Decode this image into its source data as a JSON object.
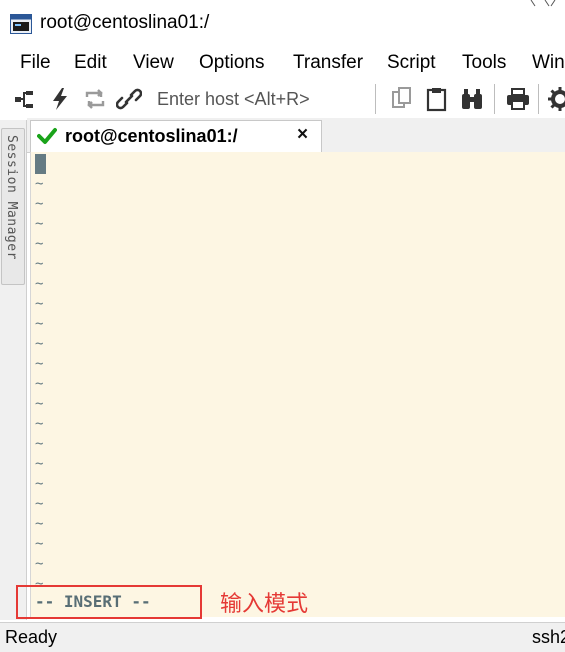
{
  "window": {
    "title": "root@centoslina01:/"
  },
  "menu": [
    "File",
    "Edit",
    "View",
    "Options",
    "Transfer",
    "Script",
    "Tools",
    "Win"
  ],
  "toolbar": {
    "host_placeholder": "Enter host <Alt+R>",
    "icons": [
      "connect-tree-icon",
      "lightning-icon",
      "reconnect-icon",
      "link-icon",
      "copy-icon",
      "paste-icon",
      "find-binoculars-icon",
      "print-icon",
      "settings-icon"
    ]
  },
  "side_panel": {
    "label": "Session Manager"
  },
  "tab": {
    "label": "root@centoslina01:/",
    "close": "×",
    "status_color": "#1aa31a"
  },
  "terminal": {
    "empty_line_marker": "~",
    "line_count": 21,
    "mode_text": "-- INSERT --",
    "background": "#fdf6e3",
    "foreground": "#657b83"
  },
  "annotation": {
    "text": "输入模式",
    "color": "#e53935"
  },
  "statusbar": {
    "left": "Ready",
    "right": "ssh2"
  }
}
